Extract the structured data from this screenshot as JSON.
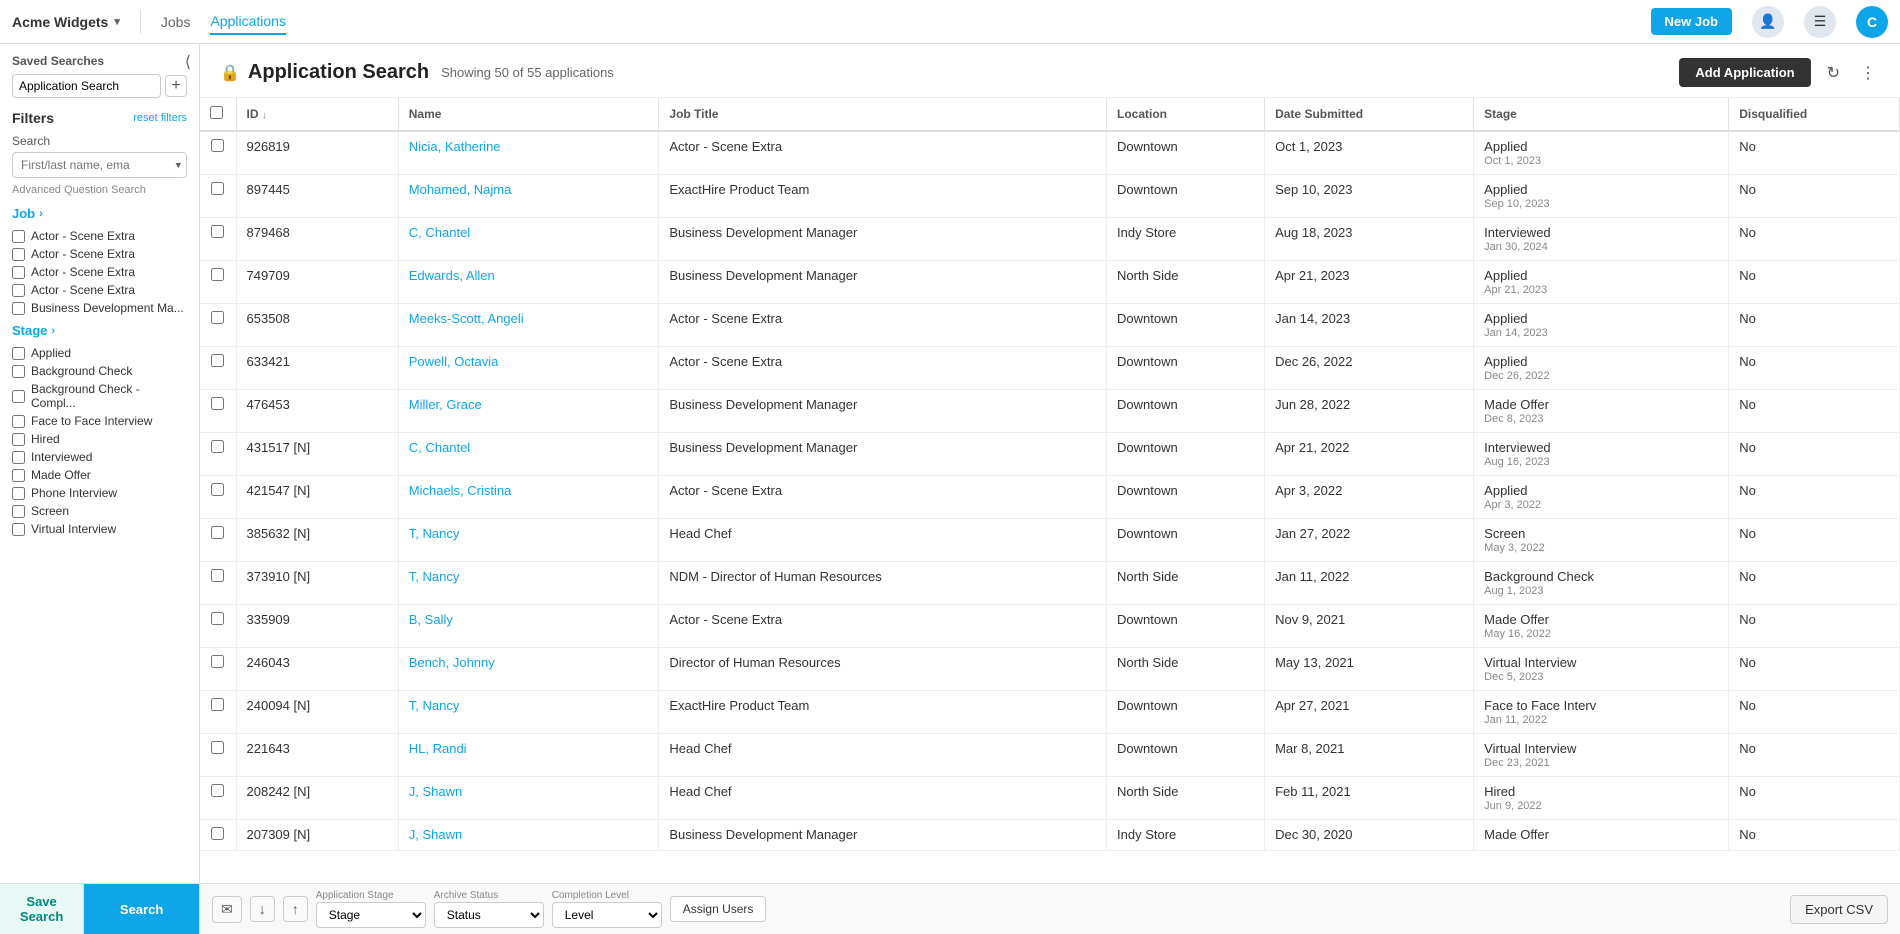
{
  "nav": {
    "brand": "Acme Widgets",
    "links": [
      "Jobs",
      "Applications"
    ],
    "active_link": "Applications",
    "new_job_label": "New Job",
    "user_initial": "C"
  },
  "sidebar": {
    "saved_searches_label": "Saved Searches",
    "saved_search_value": "Application Search",
    "filters_title": "Filters",
    "reset_label": "reset filters",
    "search_label": "Search",
    "search_placeholder": "First/last name, ema",
    "adv_search_label": "Advanced Question Search",
    "job_section_label": "Job",
    "job_items": [
      "Actor - Scene Extra",
      "Actor - Scene Extra",
      "Actor - Scene Extra",
      "Actor - Scene Extra",
      "Business Development Ma..."
    ],
    "stage_section_label": "Stage",
    "stage_items": [
      "Applied",
      "Background Check",
      "Background Check - Compl...",
      "Face to Face Interview",
      "Hired",
      "Interviewed",
      "Made Offer",
      "Phone Interview",
      "Screen",
      "Virtual Interview"
    ],
    "save_search_label": "Save Search",
    "search_button_label": "Search"
  },
  "main": {
    "page_title": "Application Search",
    "showing_text": "Showing 50 of 55 applications",
    "add_app_label": "Add Application",
    "columns": [
      "",
      "ID",
      "Name",
      "Job Title",
      "Location",
      "Date Submitted",
      "Stage",
      "Disqualified"
    ],
    "rows": [
      {
        "id": "926819",
        "name": "Nicia, Katherine",
        "job_title": "Actor - Scene Extra",
        "location": "Downtown",
        "date_submitted": "Oct 1, 2023",
        "stage": "Applied",
        "stage_date": "Oct 1, 2023",
        "disqualified": "No"
      },
      {
        "id": "897445",
        "name": "Mohamed, Najma",
        "job_title": "ExactHire Product Team",
        "location": "Downtown",
        "date_submitted": "Sep 10, 2023",
        "stage": "Applied",
        "stage_date": "Sep 10, 2023",
        "disqualified": "No"
      },
      {
        "id": "879468",
        "name": "C, Chantel",
        "job_title": "Business Development Manager",
        "location": "Indy Store",
        "date_submitted": "Aug 18, 2023",
        "stage": "Interviewed",
        "stage_date": "Jan 30, 2024",
        "disqualified": "No"
      },
      {
        "id": "749709",
        "name": "Edwards, Allen",
        "job_title": "Business Development Manager",
        "location": "North Side",
        "date_submitted": "Apr 21, 2023",
        "stage": "Applied",
        "stage_date": "Apr 21, 2023",
        "disqualified": "No"
      },
      {
        "id": "653508",
        "name": "Meeks-Scott, Angeli",
        "job_title": "Actor - Scene Extra",
        "location": "Downtown",
        "date_submitted": "Jan 14, 2023",
        "stage": "Applied",
        "stage_date": "Jan 14, 2023",
        "disqualified": "No"
      },
      {
        "id": "633421",
        "name": "Powell, Octavia",
        "job_title": "Actor - Scene Extra",
        "location": "Downtown",
        "date_submitted": "Dec 26, 2022",
        "stage": "Applied",
        "stage_date": "Dec 26, 2022",
        "disqualified": "No"
      },
      {
        "id": "476453",
        "name": "Miller, Grace",
        "job_title": "Business Development Manager",
        "location": "Downtown",
        "date_submitted": "Jun 28, 2022",
        "stage": "Made Offer",
        "stage_date": "Dec 8, 2023",
        "disqualified": "No"
      },
      {
        "id": "431517 [N]",
        "name": "C, Chantel",
        "job_title": "Business Development Manager",
        "location": "Downtown",
        "date_submitted": "Apr 21, 2022",
        "stage": "Interviewed",
        "stage_date": "Aug 16, 2023",
        "disqualified": "No"
      },
      {
        "id": "421547 [N]",
        "name": "Michaels, Cristina",
        "job_title": "Actor - Scene Extra",
        "location": "Downtown",
        "date_submitted": "Apr 3, 2022",
        "stage": "Applied",
        "stage_date": "Apr 3, 2022",
        "disqualified": "No"
      },
      {
        "id": "385632 [N]",
        "name": "T, Nancy",
        "job_title": "Head Chef",
        "location": "Downtown",
        "date_submitted": "Jan 27, 2022",
        "stage": "Screen",
        "stage_date": "May 3, 2022",
        "disqualified": "No"
      },
      {
        "id": "373910 [N]",
        "name": "T, Nancy",
        "job_title": "NDM - Director of Human Resources",
        "location": "North Side",
        "date_submitted": "Jan 11, 2022",
        "stage": "Background Check",
        "stage_date": "Aug 1, 2023",
        "disqualified": "No"
      },
      {
        "id": "335909",
        "name": "B, Sally",
        "job_title": "Actor - Scene Extra",
        "location": "Downtown",
        "date_submitted": "Nov 9, 2021",
        "stage": "Made Offer",
        "stage_date": "May 16, 2022",
        "disqualified": "No"
      },
      {
        "id": "246043",
        "name": "Bench, Johnny",
        "job_title": "Director of Human Resources",
        "location": "North Side",
        "date_submitted": "May 13, 2021",
        "stage": "Virtual Interview",
        "stage_date": "Dec 5, 2023",
        "disqualified": "No"
      },
      {
        "id": "240094 [N]",
        "name": "T, Nancy",
        "job_title": "ExactHire Product Team",
        "location": "Downtown",
        "date_submitted": "Apr 27, 2021",
        "stage": "Face to Face Interv",
        "stage_date": "Jan 11, 2022",
        "disqualified": "No"
      },
      {
        "id": "221643",
        "name": "HL, Randi",
        "job_title": "Head Chef",
        "location": "Downtown",
        "date_submitted": "Mar 8, 2021",
        "stage": "Virtual Interview",
        "stage_date": "Dec 23, 2021",
        "disqualified": "No"
      },
      {
        "id": "208242 [N]",
        "name": "J, Shawn",
        "job_title": "Head Chef",
        "location": "North Side",
        "date_submitted": "Feb 11, 2021",
        "stage": "Hired",
        "stage_date": "Jun 9, 2022",
        "disqualified": "No"
      },
      {
        "id": "207309 [N]",
        "name": "J, Shawn",
        "job_title": "Business Development Manager",
        "location": "Indy Store",
        "date_submitted": "Dec 30, 2020",
        "stage": "Made Offer",
        "stage_date": "",
        "disqualified": "No"
      }
    ]
  },
  "bottom_toolbar": {
    "app_stage_label": "Application Stage",
    "app_stage_placeholder": "Stage",
    "archive_status_label": "Archive Status",
    "archive_status_placeholder": "Status",
    "completion_level_label": "Completion Level",
    "completion_level_placeholder": "Level",
    "assign_users_label": "Assign Users",
    "export_csv_label": "Export CSV"
  }
}
